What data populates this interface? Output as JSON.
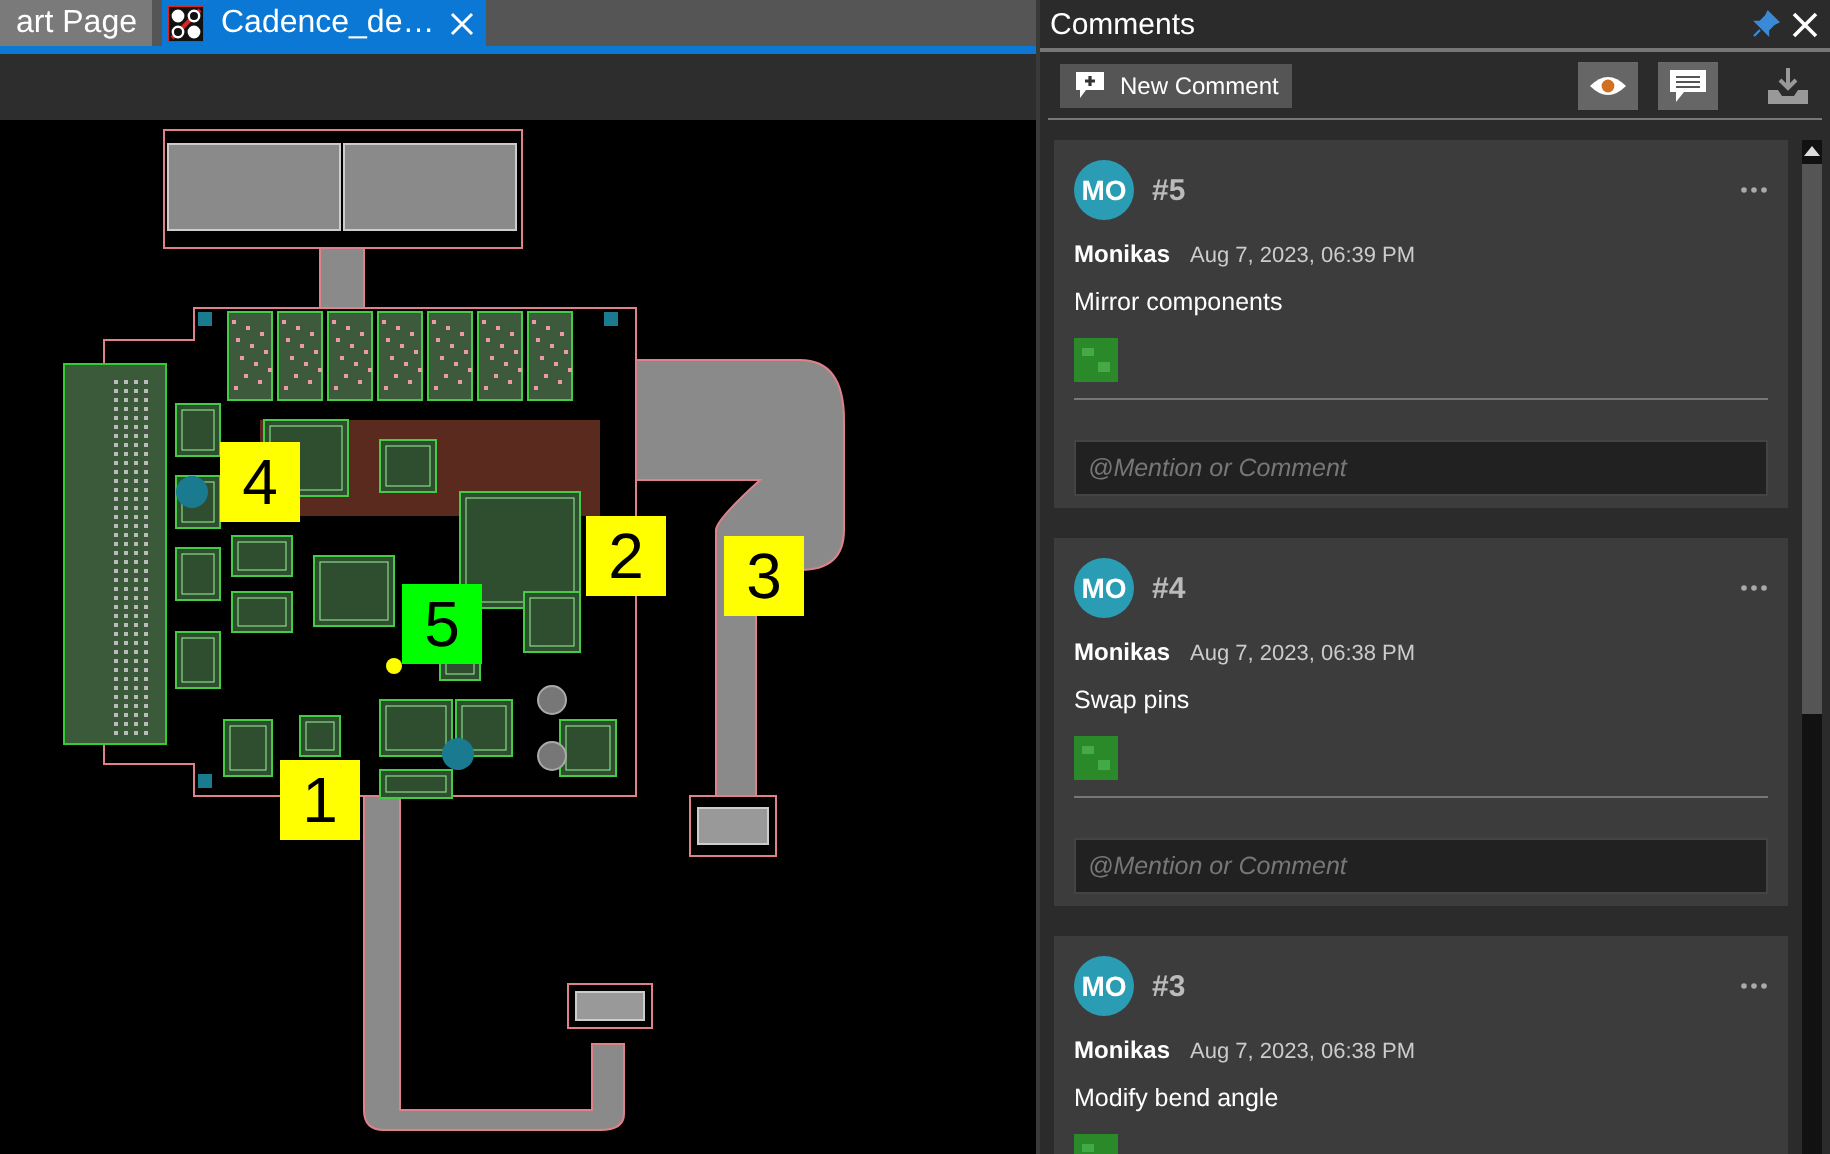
{
  "tabs": [
    {
      "label": "art Page",
      "selected": false
    },
    {
      "label": "Cadence_de…",
      "selected": true
    }
  ],
  "canvas": {
    "markers": [
      {
        "label": "4",
        "color": "#ffff00"
      },
      {
        "label": "2",
        "color": "#ffff00"
      },
      {
        "label": "3",
        "color": "#ffff00"
      },
      {
        "label": "5",
        "color": "#00ff00"
      },
      {
        "label": "1",
        "color": "#ffff00"
      }
    ]
  },
  "comments_panel": {
    "title": "Comments",
    "new_comment_button": "New Comment",
    "comments": [
      {
        "avatar": "MO",
        "number": "#5",
        "author": "Monikas",
        "date": "Aug 7, 2023, 06:39 PM",
        "text": "Mirror components",
        "placeholder": "@Mention or Comment"
      },
      {
        "avatar": "MO",
        "number": "#4",
        "author": "Monikas",
        "date": "Aug 7, 2023, 06:38 PM",
        "text": "Swap pins",
        "placeholder": "@Mention or Comment"
      },
      {
        "avatar": "MO",
        "number": "#3",
        "author": "Monikas",
        "date": "Aug 7, 2023, 06:38 PM",
        "text": "Modify bend angle"
      }
    ]
  }
}
